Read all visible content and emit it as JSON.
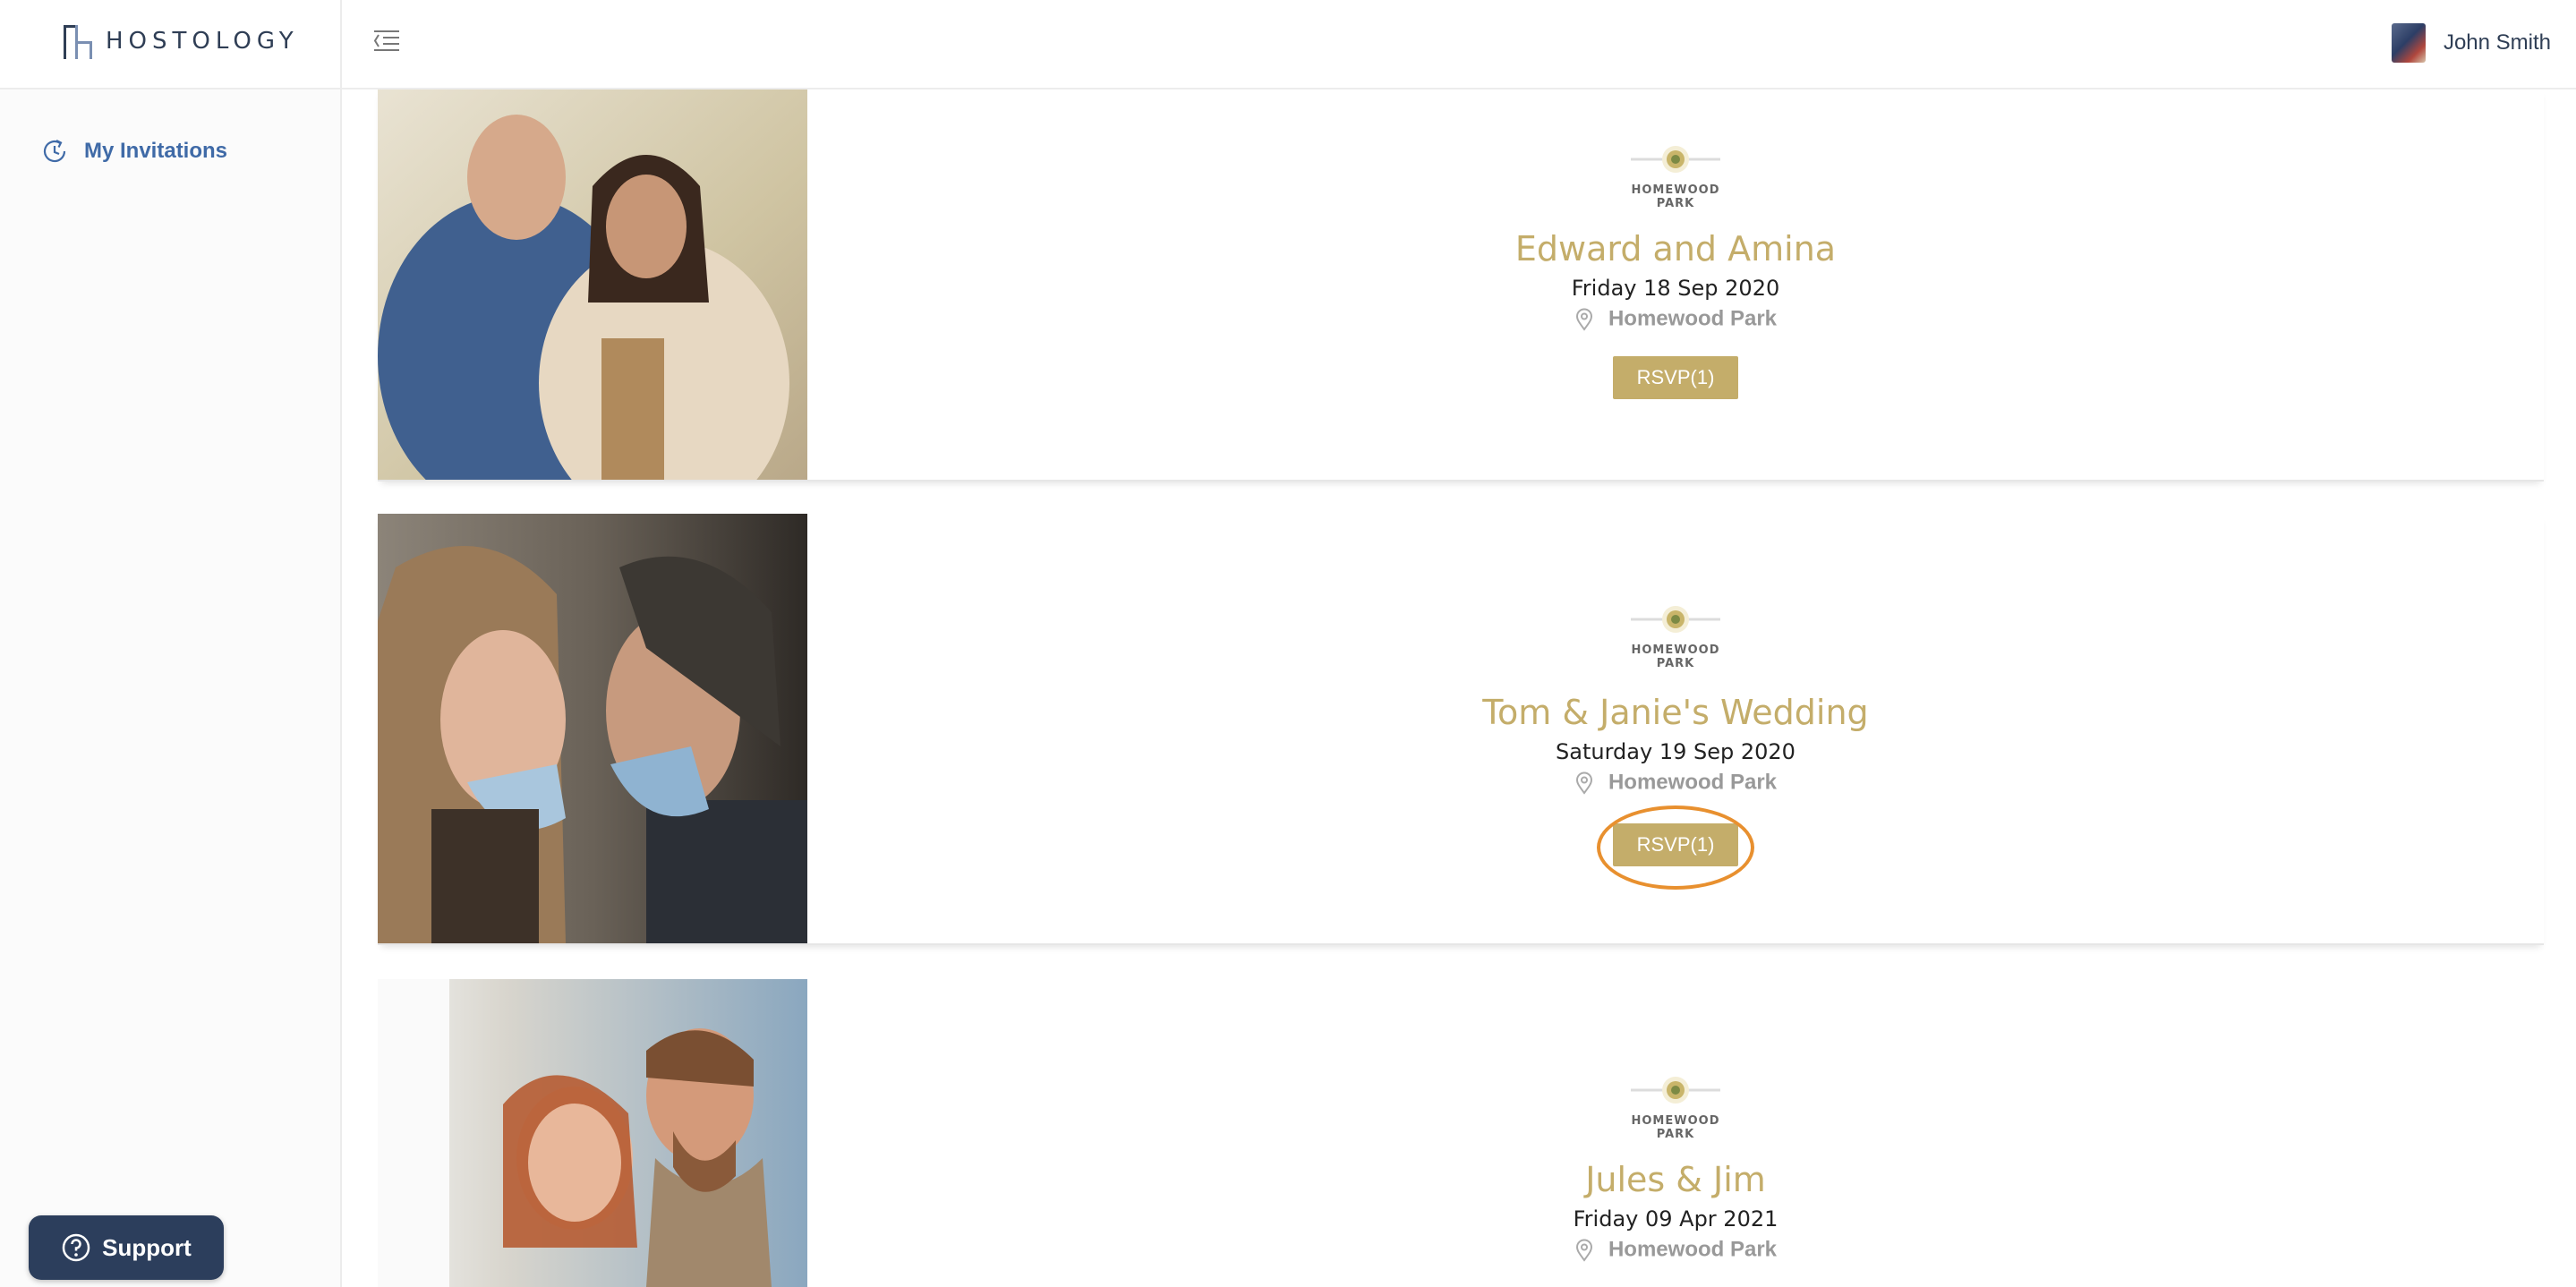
{
  "brand": {
    "name": "HOSTOLOGY"
  },
  "user": {
    "name": "John Smith"
  },
  "sidebar": {
    "items": [
      {
        "label": "My Invitations",
        "icon": "clock-icon"
      }
    ],
    "support_label": "Support"
  },
  "colors": {
    "accent": "#c4ad6a",
    "navy": "#2c3e5c",
    "link": "#3f6aa7",
    "highlight": "#e8902f"
  },
  "events": [
    {
      "title": "Edward and Amina",
      "date": "Friday 18 Sep 2020",
      "venue": "Homewood Park",
      "rsvp": "RSVP(1)",
      "logo_text": "HOMEWOOD PARK"
    },
    {
      "title": "Tom & Janie's Wedding",
      "date": "Saturday 19 Sep 2020",
      "venue": "Homewood Park",
      "rsvp": "RSVP(1)",
      "logo_text": "HOMEWOOD PARK",
      "highlighted": true
    },
    {
      "title": "Jules & Jim",
      "date": "Friday 09 Apr 2021",
      "venue": "Homewood Park",
      "logo_text": "HOMEWOOD PARK"
    }
  ]
}
